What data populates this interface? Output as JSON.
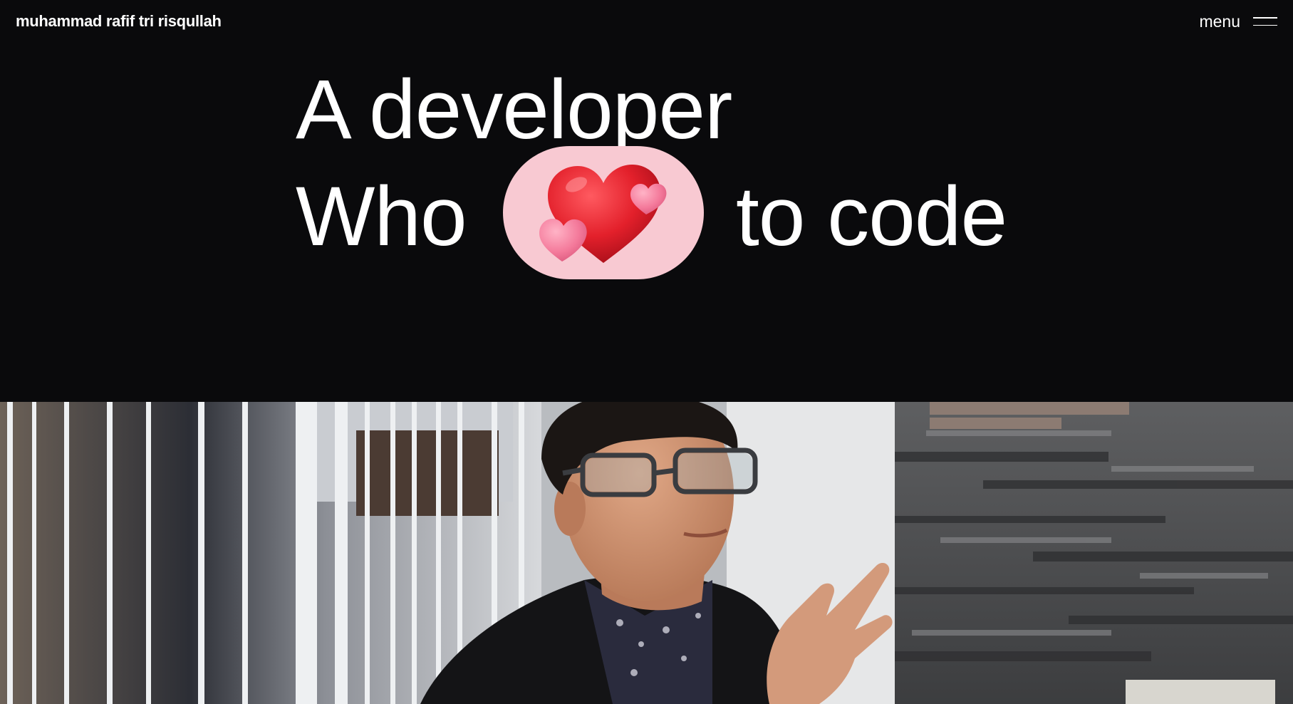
{
  "header": {
    "brand": "muhammad rafif tri risqullah",
    "menu_label": "menu",
    "menu_icon": "hamburger-icon"
  },
  "hero": {
    "line1": "A developer",
    "line2_start": "Who",
    "line2_end": "to code",
    "emoji_icon": "two-hearts-icon",
    "pill_color": "#f8c9d2"
  },
  "portrait": {
    "subject": "portrait-photo"
  },
  "colors": {
    "background": "#0a0a0c",
    "text": "#ffffff",
    "accent_pink": "#f8c9d2",
    "heart_red": "#e3202b"
  }
}
